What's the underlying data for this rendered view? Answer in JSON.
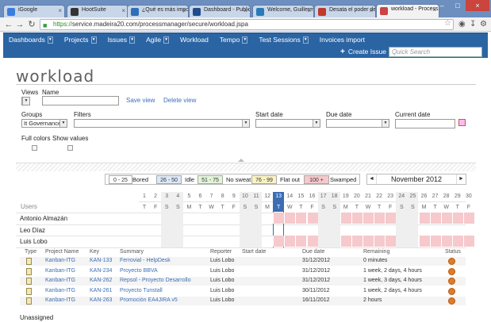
{
  "browser": {
    "tabs": [
      {
        "title": "iGoogle",
        "color": "#3b7ddd"
      },
      {
        "title": "HootSuite",
        "color": "#333333"
      },
      {
        "title": "¿Qué es más impo",
        "color": "#2e6fb7"
      },
      {
        "title": "Dashboard - Public",
        "color": "#1f4d8a"
      },
      {
        "title": "Welcome, Guillerm",
        "color": "#2a7ab8"
      },
      {
        "title": "Desata el poder de",
        "color": "#c0392b"
      },
      {
        "title": "workload - Process",
        "color": "#c44"
      }
    ],
    "url_scheme": "https://",
    "url_rest": "service.madeira20.com/processmanager/secure/workload.jspa",
    "window_controls": [
      "–",
      "□",
      "×"
    ]
  },
  "jira_nav": {
    "items": [
      {
        "label": "Dashboards",
        "dropdown": true
      },
      {
        "label": "Projects",
        "dropdown": true
      },
      {
        "label": "Issues",
        "dropdown": true
      },
      {
        "label": "Agile",
        "dropdown": true
      },
      {
        "label": "Workload",
        "dropdown": false
      },
      {
        "label": "Tempo",
        "dropdown": true
      },
      {
        "label": "Test Sessions",
        "dropdown": true
      },
      {
        "label": "Invoices import",
        "dropdown": false
      }
    ],
    "create_label": "Create Issue",
    "quick_search_placeholder": "Quick Search"
  },
  "workload": {
    "logo": "workload",
    "views_label": "Views",
    "name_label": "Name",
    "save_view": "Save view",
    "delete_view": "Delete view",
    "groups_label": "Groups",
    "groups_value": "It Governance",
    "filters_label": "Filters",
    "start_date_label": "Start date",
    "due_date_label": "Due date",
    "current_date_label": "Current date",
    "full_colors_label": "Full colors",
    "show_values_label": "Show values"
  },
  "legend": [
    {
      "range": "0 - 25",
      "label": "Bored",
      "color": "#ffffff"
    },
    {
      "range": "26 - 50",
      "label": "Idle",
      "color": "#dce8f7"
    },
    {
      "range": "51 - 75",
      "label": "No sweat",
      "color": "#e3f4d9"
    },
    {
      "range": "76 - 99",
      "label": "Flat out",
      "color": "#fbf3c4"
    },
    {
      "range": "100 +",
      "label": "Swamped",
      "color": "#f6c9cc"
    }
  ],
  "calendar": {
    "month": "November 2012",
    "prev": "◄",
    "next": "►",
    "users_label": "Users",
    "days": [
      "1",
      "2",
      "3",
      "4",
      "5",
      "6",
      "7",
      "8",
      "9",
      "10",
      "11",
      "12",
      "13",
      "14",
      "15",
      "16",
      "17",
      "18",
      "19",
      "20",
      "21",
      "22",
      "23",
      "24",
      "25",
      "26",
      "27",
      "28",
      "29",
      "30"
    ],
    "weekdays": [
      "T",
      "F",
      "S",
      "S",
      "M",
      "T",
      "W",
      "T",
      "F",
      "S",
      "S",
      "M",
      "T",
      "W",
      "T",
      "F",
      "S",
      "S",
      "M",
      "T",
      "W",
      "T",
      "F",
      "S",
      "S",
      "M",
      "T",
      "W",
      "T",
      "F"
    ],
    "today_index": 12,
    "users": [
      "Antonio Almazán",
      "Leo Díaz",
      "Luis Lobo"
    ]
  },
  "issues": {
    "headers": [
      "Type",
      "Project Name",
      "Key",
      "Summary",
      "Reporter",
      "Start date",
      "Due date",
      "Remaining",
      "Status"
    ],
    "rows": [
      {
        "project": "Kanban-ITG",
        "key": "KAN-133",
        "summary": "Ferrovial - HelpDesk",
        "reporter": "Luis Lobo",
        "start": "",
        "due": "31/12/2012",
        "remaining": "0 minutes"
      },
      {
        "project": "Kanban-ITG",
        "key": "KAN-234",
        "summary": "Proyecto BBVA",
        "reporter": "Luis Lobo",
        "start": "",
        "due": "31/12/2012",
        "remaining": "1 week, 2 days, 4 hours"
      },
      {
        "project": "Kanban-ITG",
        "key": "KAN-262",
        "summary": "Repsol - Proyecto Desarrollo",
        "reporter": "Luis Lobo",
        "start": "",
        "due": "31/12/2012",
        "remaining": "1 week, 3 days, 4 hours"
      },
      {
        "project": "Kanban-ITG",
        "key": "KAN-261",
        "summary": "Proyecto Tunstall",
        "reporter": "Luis Lobo",
        "start": "",
        "due": "30/11/2012",
        "remaining": "1 week, 2 days, 4 hours"
      },
      {
        "project": "Kanban-ITG",
        "key": "KAN-263",
        "summary": "Promoción EA4JIRA v5",
        "reporter": "Luis Lobo",
        "start": "",
        "due": "16/11/2012",
        "remaining": "2 hours"
      }
    ]
  },
  "unassigned_label": "Unassigned"
}
